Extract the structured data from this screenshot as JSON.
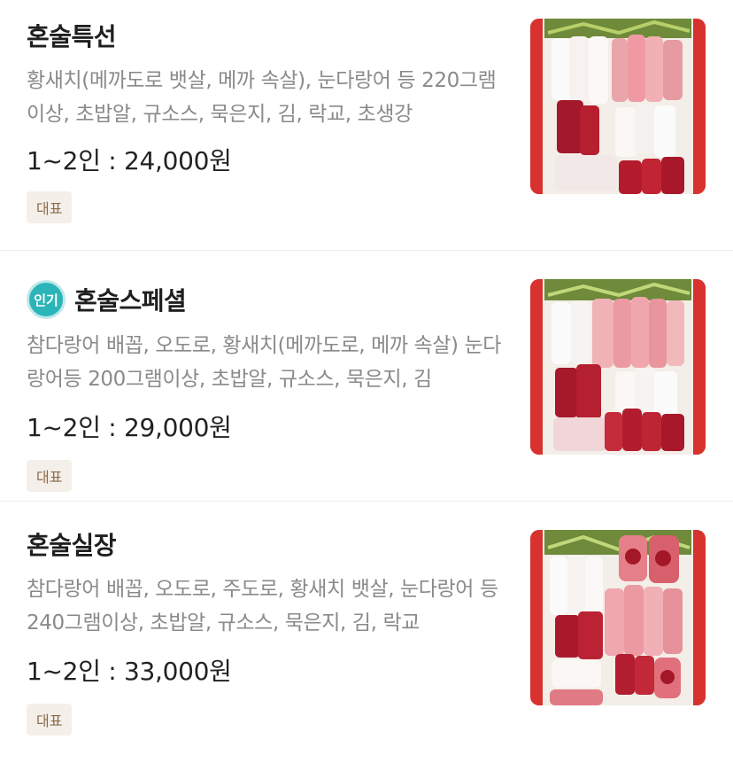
{
  "menu_items": [
    {
      "title": "혼술특선",
      "badge": "",
      "description": "황새치(메까도로 뱃살, 메까 속살), 눈다랑어 등 220그램이상, 초밥알, 규소스, 묵은지, 김, 락교, 초생강",
      "price": "1~2인 : 24,000원",
      "tag": "대표",
      "image_icon": "sashimi-platter"
    },
    {
      "title": "혼술스페셜",
      "badge": "인기",
      "description": "참다랑어 배꼽, 오도로, 황새치(메까도로, 메까 속살) 눈다랑어등 200그램이상, 초밥알, 규소스, 묵은지, 김",
      "price": "1~2인 : 29,000원",
      "tag": "대표",
      "image_icon": "sashimi-platter"
    },
    {
      "title": "혼술실장",
      "badge": "",
      "description": "참다랑어 배꼽, 오도로, 주도로, 황새치 뱃살, 눈다랑어 등 240그램이상, 초밥알, 규소스, 묵은지, 김, 락교",
      "price": "1~2인 : 33,000원",
      "tag": "대표",
      "image_icon": "sashimi-platter"
    }
  ],
  "colors": {
    "popular_badge": "#2bb5b8",
    "tag_background": "#f4efe9",
    "tag_text": "#8b6b4c",
    "tray_red": "#d8322f"
  }
}
